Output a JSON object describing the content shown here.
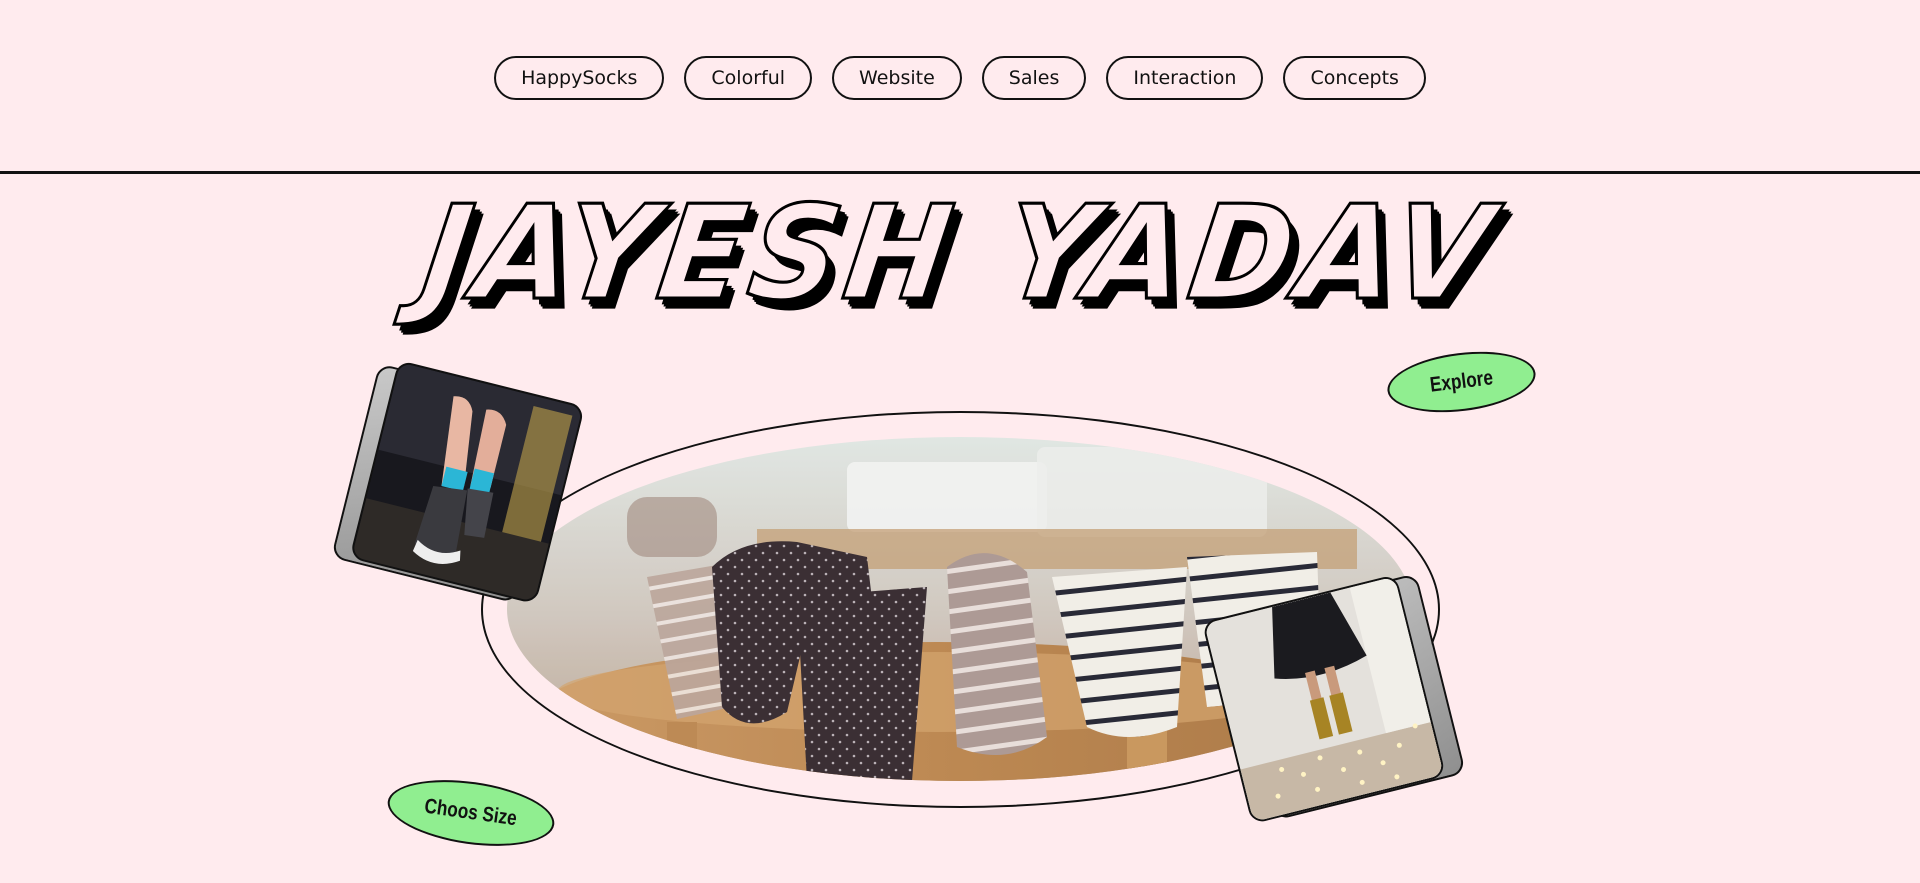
{
  "nav": {
    "items": [
      {
        "label": "HappySocks"
      },
      {
        "label": "Colorful"
      },
      {
        "label": "Website"
      },
      {
        "label": "Sales"
      },
      {
        "label": "Interaction"
      },
      {
        "label": "Concepts"
      }
    ]
  },
  "hero": {
    "title": "JAYESH YADAV"
  },
  "actions": {
    "explore_label": "Explore",
    "choose_size_label": "Choos Size"
  },
  "colors": {
    "background": "#ffebee",
    "accent_green": "#90ee90",
    "ink": "#111111"
  }
}
